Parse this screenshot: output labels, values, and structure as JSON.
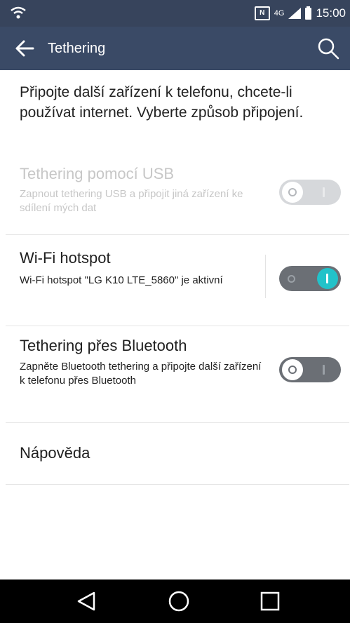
{
  "status_bar": {
    "time": "15:00",
    "nfc_label": "N",
    "network_label": "4G",
    "icons": [
      "wifi-icon",
      "nfc-icon",
      "signal-icon",
      "battery-icon"
    ]
  },
  "app_bar": {
    "title": "Tethering",
    "icons": [
      "back-arrow-icon",
      "search-icon"
    ]
  },
  "intro_text": "Připojte další zařízení k telefonu, chcete-li používat internet. Vyberte způsob připojení.",
  "settings": [
    {
      "title": "Tethering pomocí USB",
      "subtitle": "Zapnout tethering USB a připojit jiná zařízení ke sdílení mých dat",
      "enabled": false,
      "toggled": false
    },
    {
      "title": "Wi-Fi hotspot",
      "subtitle": "Wi-Fi hotspot \"LG K10 LTE_5860\" je aktivní",
      "enabled": true,
      "toggled": true
    },
    {
      "title": "Tethering přes Bluetooth",
      "subtitle": "Zapněte Bluetooth tethering a připojte další zařízení k telefonu přes Bluetooth",
      "enabled": true,
      "toggled": false
    }
  ],
  "help_label": "Nápověda",
  "nav_bar": {
    "icons": [
      "back-triangle-icon",
      "home-circle-icon",
      "recents-square-icon"
    ]
  },
  "colors": {
    "status_bar": "#37445c",
    "app_bar": "#3a4a66",
    "toggle_on_accent": "#22c2c9",
    "toggle_track": "#6b6f75"
  }
}
